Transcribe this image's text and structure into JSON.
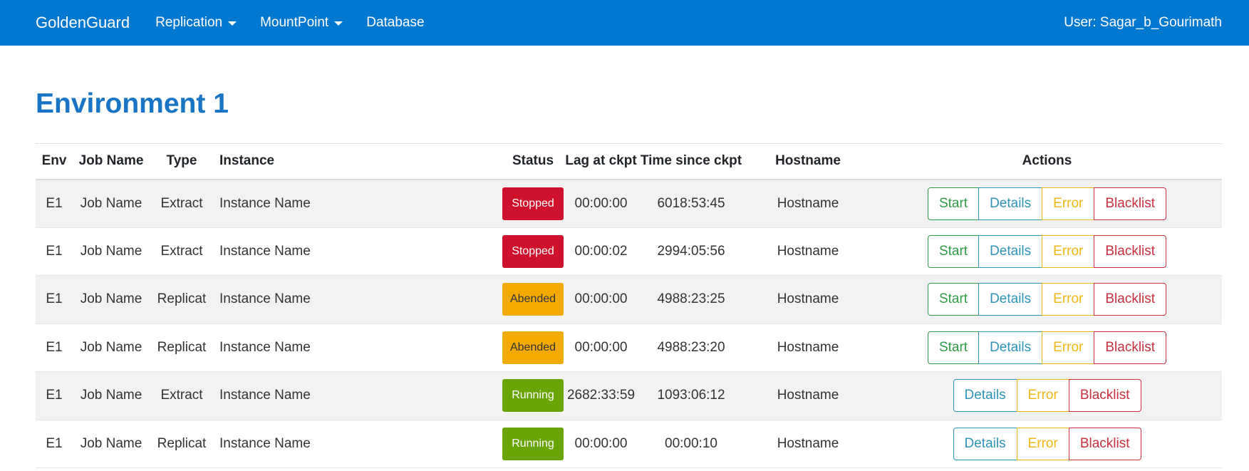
{
  "navbar": {
    "brand": "GoldenGuard",
    "items": [
      {
        "label": "Replication",
        "dropdown": true
      },
      {
        "label": "MountPoint",
        "dropdown": true
      },
      {
        "label": "Database",
        "dropdown": false
      }
    ],
    "user": "User: Sagar_b_Gourimath"
  },
  "page": {
    "title": "Environment 1"
  },
  "colors": {
    "navbar": "#0078d0",
    "title": "#1a74c6",
    "stopped": "#d0112b",
    "abended": "#f2a900",
    "running": "#6aa506",
    "start": "#2f9b47",
    "details": "#2f94b6",
    "error": "#efb814",
    "blacklist": "#c8303f"
  },
  "table": {
    "headers": [
      "Env",
      "Job Name",
      "Type",
      "Instance",
      "Status",
      "Lag at ckpt",
      "Time since ckpt",
      "Hostname",
      "Actions"
    ],
    "action_labels": {
      "start": "Start",
      "details": "Details",
      "error": "Error",
      "blacklist": "Blacklist"
    },
    "rows": [
      {
        "env": "E1",
        "job": "Job Name",
        "type": "Extract",
        "instance": "Instance Name",
        "status": "Stopped",
        "lag": "00:00:00",
        "since": "6018:53:45",
        "host": "Hostname",
        "start": true
      },
      {
        "env": "E1",
        "job": "Job Name",
        "type": "Extract",
        "instance": "Instance Name",
        "status": "Stopped",
        "lag": "00:00:02",
        "since": "2994:05:56",
        "host": "Hostname",
        "start": true
      },
      {
        "env": "E1",
        "job": "Job Name",
        "type": "Replicat",
        "instance": "Instance Name",
        "status": "Abended",
        "lag": "00:00:00",
        "since": "4988:23:25",
        "host": "Hostname",
        "start": true
      },
      {
        "env": "E1",
        "job": "Job Name",
        "type": "Replicat",
        "instance": "Instance Name",
        "status": "Abended",
        "lag": "00:00:00",
        "since": "4988:23:20",
        "host": "Hostname",
        "start": true
      },
      {
        "env": "E1",
        "job": "Job Name",
        "type": "Extract",
        "instance": "Instance Name",
        "status": "Running",
        "lag": "2682:33:59",
        "since": "1093:06:12",
        "host": "Hostname",
        "start": false
      },
      {
        "env": "E1",
        "job": "Job Name",
        "type": "Replicat",
        "instance": "Instance Name",
        "status": "Running",
        "lag": "00:00:00",
        "since": "00:00:10",
        "host": "Hostname",
        "start": false
      }
    ]
  }
}
